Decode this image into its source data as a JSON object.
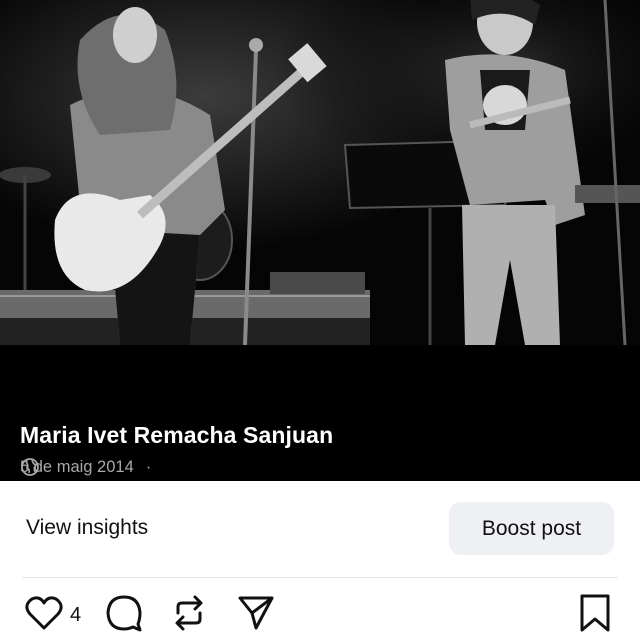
{
  "post": {
    "author": "Maria Ivet Remacha Sanjuan",
    "date": "5 de maig 2014",
    "separator": "·",
    "visibility_icon": "globe-icon",
    "photo_description_icon": "concert-photo"
  },
  "actions": {
    "view_insights": "View insights",
    "boost_post": "Boost post",
    "like_count": "4",
    "icons": [
      "heart-icon",
      "comment-icon",
      "repost-icon",
      "share-icon",
      "bookmark-icon"
    ]
  },
  "colors": {
    "photo_background": "#000000",
    "meta_text": "#a8a8a8",
    "boost_background": "#eef0f4"
  }
}
